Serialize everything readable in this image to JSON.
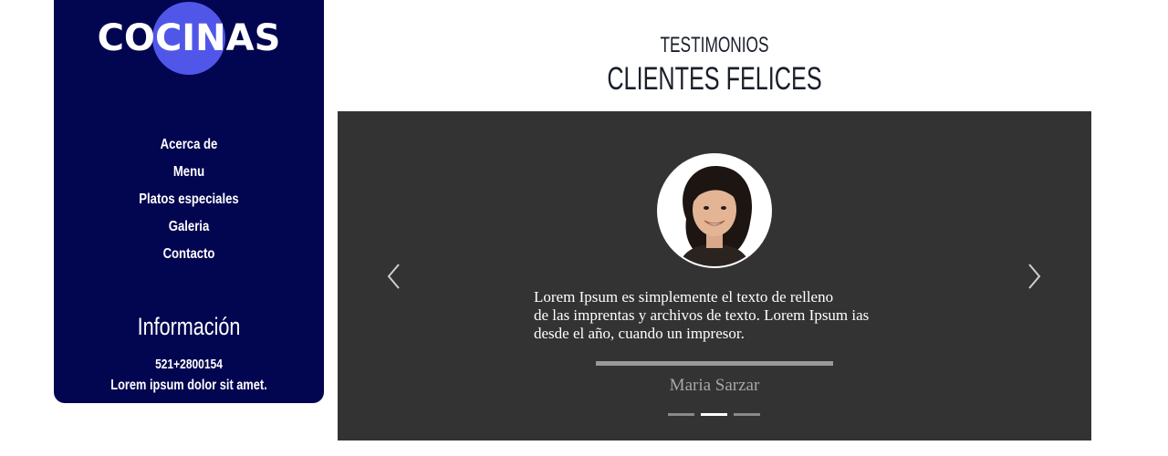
{
  "brand": {
    "logo_text": "COCINAS",
    "accent": "#5057e8",
    "sidebar_bg": "#020550"
  },
  "nav": [
    {
      "label": "Acerca de"
    },
    {
      "label": "Menu"
    },
    {
      "label": "Platos especiales"
    },
    {
      "label": "Galeria"
    },
    {
      "label": "Contacto"
    }
  ],
  "info": {
    "title": "Información",
    "phone": "521+2800154",
    "text": "Lorem ipsum dolor sit amet."
  },
  "section": {
    "subtitle": "TESTIMONIOS",
    "title": "CLIENTES FELICES"
  },
  "testimonial": {
    "quote": "Lorem Ipsum es simplemente el texto de relleno\nde las imprentas y archivos de texto. Lorem Ipsum  ias\ndesde el año, cuando un impresor.",
    "author": "Maria Sarzar",
    "avatar_icon": "person-portrait-icon",
    "active_slide": 2,
    "slide_count": 3
  },
  "icons": {
    "prev": "chevron-left-icon",
    "next": "chevron-right-icon"
  }
}
